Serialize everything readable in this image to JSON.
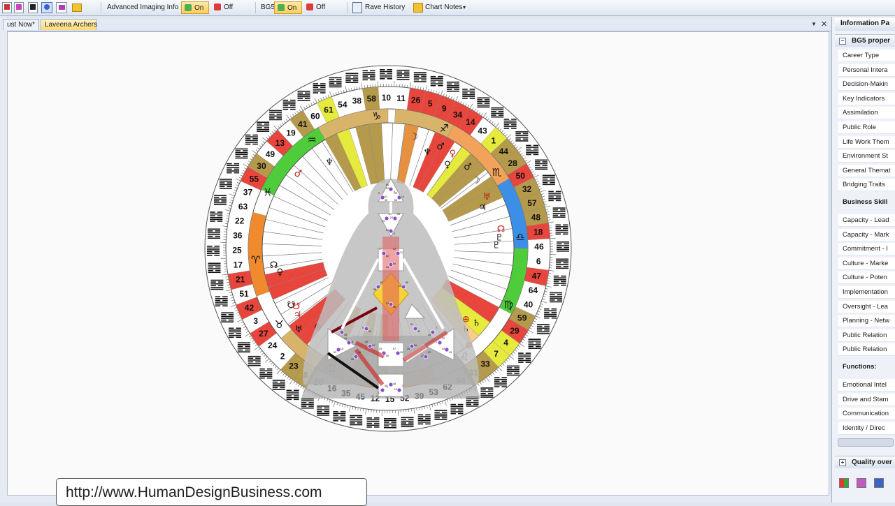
{
  "toolbar": {
    "advanced_imaging_label": "Advanced Imaging Info :",
    "advanced_on": "On",
    "advanced_off": "Off",
    "bg5_label": "BG5 :",
    "bg5_on": "On",
    "bg5_off": "Off",
    "rave_history": "Rave History",
    "chart_notes": "Chart Notes",
    "dropdown_glyph": "▾"
  },
  "tabs": [
    "ust Now*",
    "Laveena Archers"
  ],
  "tab_controls": {
    "dropdown": "▼",
    "close": "✕"
  },
  "chart": {
    "gates": [
      "10",
      "11",
      "26",
      "5",
      "9",
      "34",
      "14",
      "43",
      "1",
      "44",
      "28",
      "50",
      "32",
      "57",
      "48",
      "18",
      "46",
      "6",
      "47",
      "64",
      "40",
      "59",
      "29",
      "4",
      "7",
      "33",
      "31",
      "56",
      "62",
      "53",
      "39",
      "52",
      "15",
      "12",
      "45",
      "35",
      "16",
      "20",
      "8",
      "23",
      "2",
      "24",
      "27",
      "3",
      "42",
      "51",
      "21",
      "17",
      "25",
      "36",
      "22",
      "63",
      "37",
      "55",
      "30",
      "49",
      "13",
      "19",
      "41",
      "60",
      "61",
      "54",
      "38",
      "58"
    ],
    "signs": [
      "♑",
      "♐",
      "♏",
      "♎",
      "♍",
      "♌",
      "♋",
      "♊",
      "♉",
      "♈",
      "♓",
      "♒"
    ],
    "planet_glyphs": [
      "☽",
      "♂",
      "♀",
      "♆",
      "♀",
      "⊕",
      "♂",
      "☽",
      "♅",
      "♃",
      "♄",
      "☊",
      "♇",
      "♇",
      "⊕",
      "♄",
      "♅",
      "♃",
      "⊕",
      "☊",
      "♂",
      "☋",
      "♀",
      "☋",
      "♆"
    ],
    "band_colors": {
      "red": "#e8453c",
      "green": "#4fcc3a",
      "yellow": "#e6ea3c",
      "olive": "#b59a4c",
      "orange": "#f08a2c",
      "blue": "#3c8fe6"
    }
  },
  "bodygraph": {
    "gate_numbers": [
      "64",
      "61",
      "63",
      "47",
      "24",
      "4",
      "17",
      "11",
      "43",
      "62",
      "23",
      "56",
      "31",
      "8",
      "33",
      "7",
      "1",
      "13",
      "25",
      "15",
      "2",
      "46",
      "10",
      "34",
      "51",
      "21",
      "26",
      "40",
      "37",
      "6",
      "5",
      "14",
      "29",
      "59",
      "53",
      "60",
      "52",
      "54",
      "38",
      "58",
      "19",
      "39",
      "41",
      "18",
      "28",
      "32",
      "44",
      "50",
      "57",
      "48",
      "27",
      "3",
      "9",
      "42",
      "30",
      "36",
      "35",
      "22",
      "12",
      "55",
      "49"
    ]
  },
  "url": "http://www.HumanDesignBusiness.com",
  "info_panel": {
    "title": "Information Pa",
    "group1": "BG5 proper",
    "items1": [
      "Career Type",
      "Personal Intera",
      "Decision-Makin",
      "Key Indicators",
      "Assimilation",
      "Public Role",
      "Life Work Them",
      "Environment St",
      "General Themat",
      "Bridging Traits"
    ],
    "section_business": "Business Skill",
    "items2": [
      "Capacity - Lead",
      "Capacity - Mark",
      "Commitment - I",
      "Culture - Marke",
      "Culture - Poten",
      "Implementation",
      "Oversight - Lea",
      "Planning - Netw",
      "Public Relation",
      "Public Relation"
    ],
    "section_functions": "Functions:",
    "items3": [
      "Emotional Intel",
      "Drive and Stam",
      "Communication",
      "Identity / Direc"
    ],
    "group2": "Quality over"
  }
}
